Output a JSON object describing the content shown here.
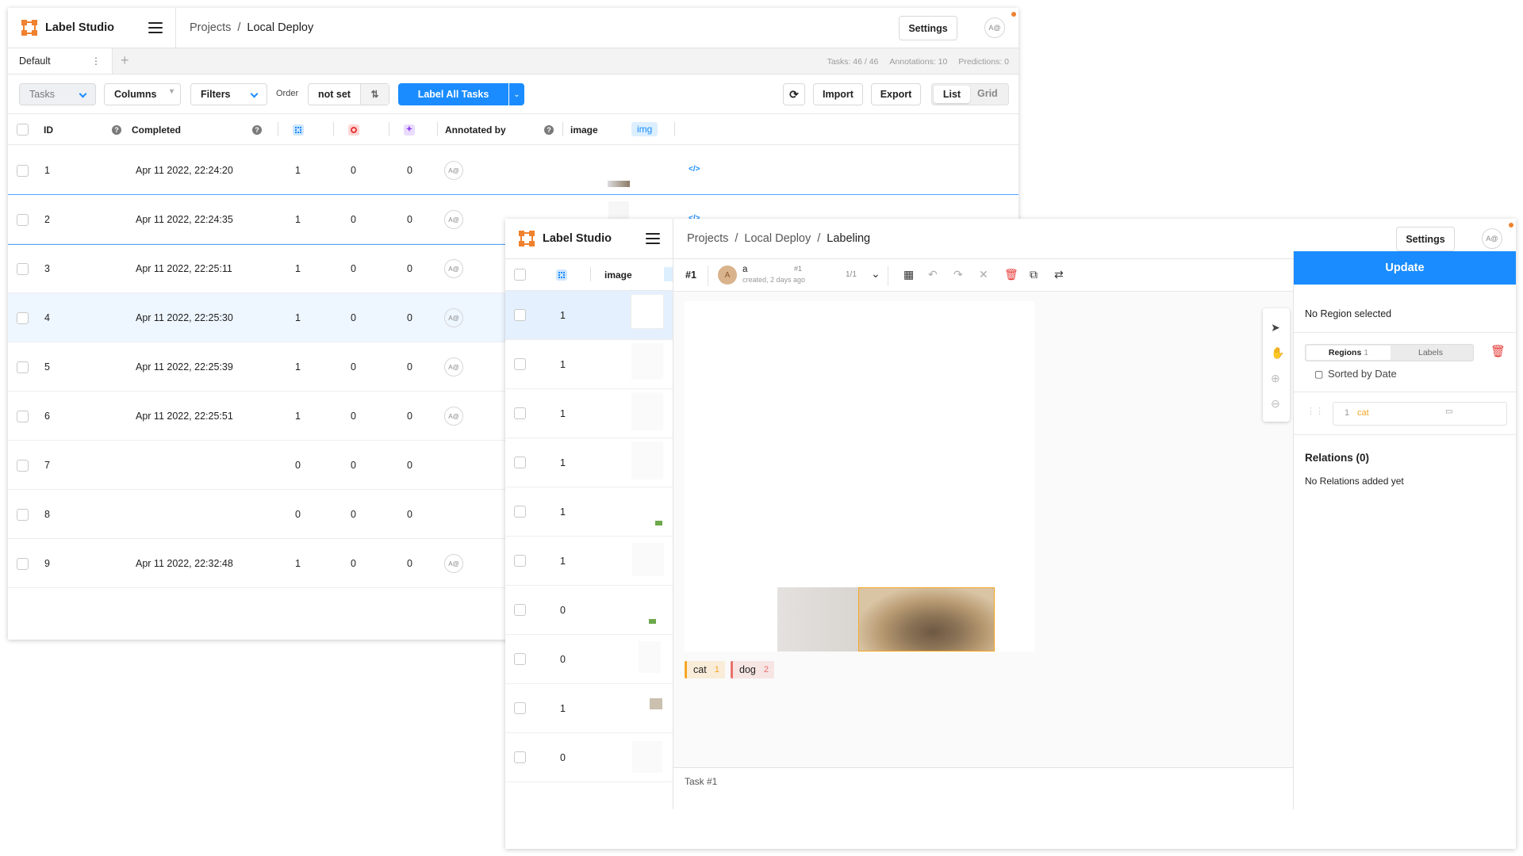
{
  "app": {
    "name": "Label Studio"
  },
  "w1": {
    "breadcrumb": [
      "Projects",
      "Local Deploy"
    ],
    "settings": "Settings",
    "avatar": "A@",
    "tab_default": "Default",
    "stats": {
      "tasks": "Tasks: 46 / 46",
      "annotations": "Annotations: 10",
      "predictions": "Predictions: 0"
    },
    "toolbar": {
      "tasks": "Tasks",
      "columns": "Columns",
      "filters": "Filters",
      "order_label": "Order",
      "order_value": "not set",
      "label_all": "Label All Tasks",
      "import": "Import",
      "export": "Export",
      "list": "List",
      "grid": "Grid"
    },
    "columns": {
      "id": "ID",
      "completed": "Completed",
      "annotated_by": "Annotated by",
      "image": "image",
      "img_tag": "img"
    },
    "rows": [
      {
        "id": "1",
        "completed": "Apr 11 2022, 22:24:20",
        "a": "1",
        "b": "0",
        "c": "0",
        "avatar": "A@"
      },
      {
        "id": "2",
        "completed": "Apr 11 2022, 22:24:35",
        "a": "1",
        "b": "0",
        "c": "0",
        "avatar": "A@"
      },
      {
        "id": "3",
        "completed": "Apr 11 2022, 22:25:11",
        "a": "1",
        "b": "0",
        "c": "0",
        "avatar": "A@"
      },
      {
        "id": "4",
        "completed": "Apr 11 2022, 22:25:30",
        "a": "1",
        "b": "0",
        "c": "0",
        "avatar": "A@"
      },
      {
        "id": "5",
        "completed": "Apr 11 2022, 22:25:39",
        "a": "1",
        "b": "0",
        "c": "0",
        "avatar": "A@"
      },
      {
        "id": "6",
        "completed": "Apr 11 2022, 22:25:51",
        "a": "1",
        "b": "0",
        "c": "0",
        "avatar": "A@"
      },
      {
        "id": "7",
        "completed": "",
        "a": "0",
        "b": "0",
        "c": "0",
        "avatar": ""
      },
      {
        "id": "8",
        "completed": "",
        "a": "0",
        "b": "0",
        "c": "0",
        "avatar": ""
      },
      {
        "id": "9",
        "completed": "Apr 11 2022, 22:32:48",
        "a": "1",
        "b": "0",
        "c": "0",
        "avatar": "A@"
      }
    ],
    "code_icon": "</>"
  },
  "w2": {
    "breadcrumb": [
      "Projects",
      "Local Deploy",
      "Labeling"
    ],
    "settings": "Settings",
    "avatar": "A@",
    "list_header_image": "image",
    "list_counts": [
      "1",
      "1",
      "1",
      "1",
      "1",
      "1",
      "0",
      "0",
      "1",
      "0"
    ],
    "task_id": "#1",
    "annotator": {
      "initial": "A",
      "name": "a",
      "created": "created, 2 days ago",
      "num": "#1"
    },
    "pager": "1/1",
    "update": "Update",
    "no_region": "No Region selected",
    "regions_tab": "Regions",
    "regions_count": "1",
    "labels_tab": "Labels",
    "sorted_by": "Sorted by Date",
    "region_item": {
      "num": "1",
      "label": "cat"
    },
    "relations_title": "Relations (0)",
    "relations_empty": "No Relations added yet",
    "labels": [
      {
        "name": "cat",
        "hotkey": "1",
        "color": "#f5a623"
      },
      {
        "name": "dog",
        "hotkey": "2",
        "color": "#e8716a"
      }
    ],
    "footer": "Task #1"
  },
  "colors": {
    "accent": "#1a8cff",
    "brand": "#f0812e",
    "danger": "#e53935"
  }
}
